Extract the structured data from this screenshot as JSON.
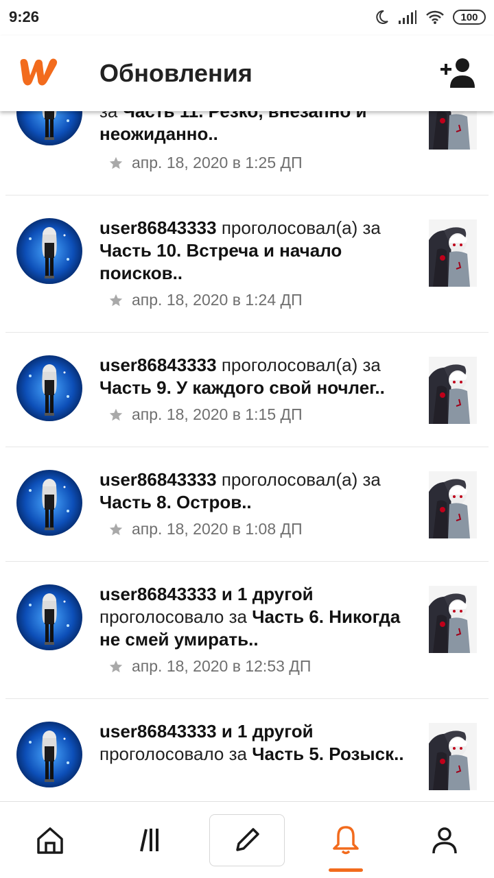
{
  "status_bar": {
    "time": "9:26",
    "battery": "100"
  },
  "header": {
    "title": "Обновления",
    "logo_icon": "wattpad-logo-icon",
    "action_icon": "add-friend-icon"
  },
  "colors": {
    "accent": "#f26b1d"
  },
  "feed": [
    {
      "user": "",
      "action": "за",
      "chapter": "Часть 11. Резко, внезапно и неожиданно..",
      "time": "апр. 18, 2020 в 1:25 ДП"
    },
    {
      "user": "user86843333",
      "action": " проголосовал(а) за ",
      "chapter": "Часть 10. Встреча и начало поисков..",
      "time": "апр. 18, 2020 в 1:24 ДП"
    },
    {
      "user": "user86843333",
      "action": " проголосовал(а) за ",
      "chapter": "Часть 9. У каждого свой ночлег..",
      "time": "апр. 18, 2020 в 1:15 ДП"
    },
    {
      "user": "user86843333",
      "action": " проголосовал(а) за ",
      "chapter": "Часть 8. Остров..",
      "time": "апр. 18, 2020 в 1:08 ДП"
    },
    {
      "user": "user86843333 и 1 другой",
      "action": " проголосовало за ",
      "chapter": "Часть 6. Никогда не смей умирать..",
      "time": "апр. 18, 2020 в 12:53 ДП"
    },
    {
      "user": "user86843333 и 1 другой",
      "action": " проголосовало за ",
      "chapter": "Часть 5. Розыск..",
      "time": ""
    }
  ],
  "bottom_nav": [
    {
      "name": "home",
      "icon": "home-icon"
    },
    {
      "name": "library",
      "icon": "library-icon"
    },
    {
      "name": "write",
      "icon": "pencil-icon"
    },
    {
      "name": "notifications",
      "icon": "bell-icon",
      "active": true
    },
    {
      "name": "profile",
      "icon": "profile-icon"
    }
  ]
}
